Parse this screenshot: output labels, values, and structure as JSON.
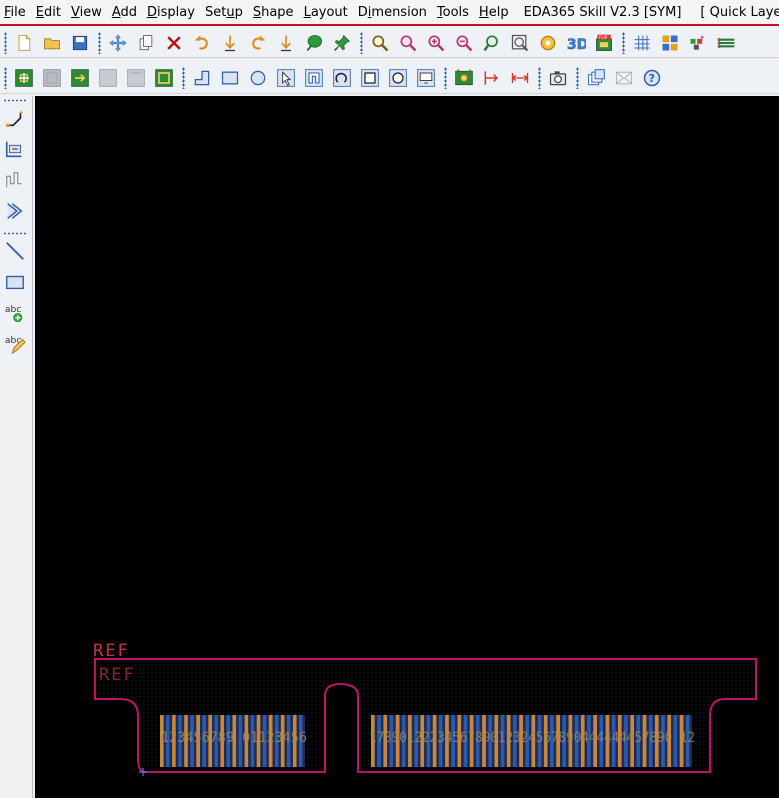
{
  "menu": {
    "items": [
      {
        "key": "file",
        "label": "File",
        "accel": "F"
      },
      {
        "key": "edit",
        "label": "Edit",
        "accel": "E"
      },
      {
        "key": "view",
        "label": "View",
        "accel": "V"
      },
      {
        "key": "add",
        "label": "Add",
        "accel": "A"
      },
      {
        "key": "display",
        "label": "Display",
        "accel": "D"
      },
      {
        "key": "setup",
        "label": "Setup",
        "accel": "u"
      },
      {
        "key": "shape",
        "label": "Shape",
        "accel": "S"
      },
      {
        "key": "layout",
        "label": "Layout",
        "accel": "L"
      },
      {
        "key": "dimension",
        "label": "Dimension",
        "accel": "i"
      },
      {
        "key": "tools",
        "label": "Tools",
        "accel": "T"
      },
      {
        "key": "help",
        "label": "Help",
        "accel": "H"
      }
    ],
    "app_title": "EDA365 Skill V2.3 [SYM]",
    "quick_layer": "[ Quick Layer ]"
  },
  "toolbar_top": [
    "new-file-icon",
    "open-folder-icon",
    "save-icon",
    "|",
    "move-icon",
    "copy-icon",
    "delete-icon",
    "undo-icon",
    "undo-drop-icon",
    "redo-icon",
    "redo-drop-icon",
    "etch-bubble-icon",
    "pin-icon",
    "|",
    "zoom-fit-icon",
    "zoom-points-icon",
    "zoom-in-icon",
    "zoom-out-icon",
    "zoom-previous-icon",
    "zoom-world-icon",
    "redraw-icon",
    "3d-view-icon",
    "flip-board-icon",
    "|",
    "grid-icon",
    "color-icon",
    "shadow-icon",
    "xsection-icon"
  ],
  "toolbar_second": [
    "place-symbol-icon",
    "gray-square-icon",
    "export-symbol-icon",
    "gray-square-2-icon",
    "gray-square-3-icon",
    "green-square-icon",
    "|",
    "add-pin-icon",
    "rectangle-icon",
    "circle-icon",
    "select-icon",
    "frame-icon",
    "arc-icon",
    "square-outline-icon",
    "circle-outline-icon",
    "monitor-icon",
    "|",
    "padstack-icon",
    "dim-point-icon",
    "dim-line-icon",
    "|",
    "camera-icon",
    "|",
    "windows-icon",
    "ratsnest-icon",
    "help-icon"
  ],
  "side_toolbar": [
    "route-icon",
    "slide-icon",
    "delay-tune-icon",
    "fanout-icon",
    "|",
    "line-icon",
    "rect-shape-icon",
    "text-add-icon",
    "text-edit-icon"
  ],
  "canvas": {
    "ref_label_outer": "REF",
    "ref_label_inner": "REF",
    "pin_text_left": "123456789 01123456",
    "pin_text_right": "1789012223456789012324567890444444457890 12",
    "colors": {
      "background": "#000000",
      "outline": "#c0106b",
      "pad_orange": "#c8873b",
      "pad_blue": "#2c5aa8",
      "ref_text": "#c0304a"
    },
    "left_pins": 24,
    "right_pins": 52
  }
}
